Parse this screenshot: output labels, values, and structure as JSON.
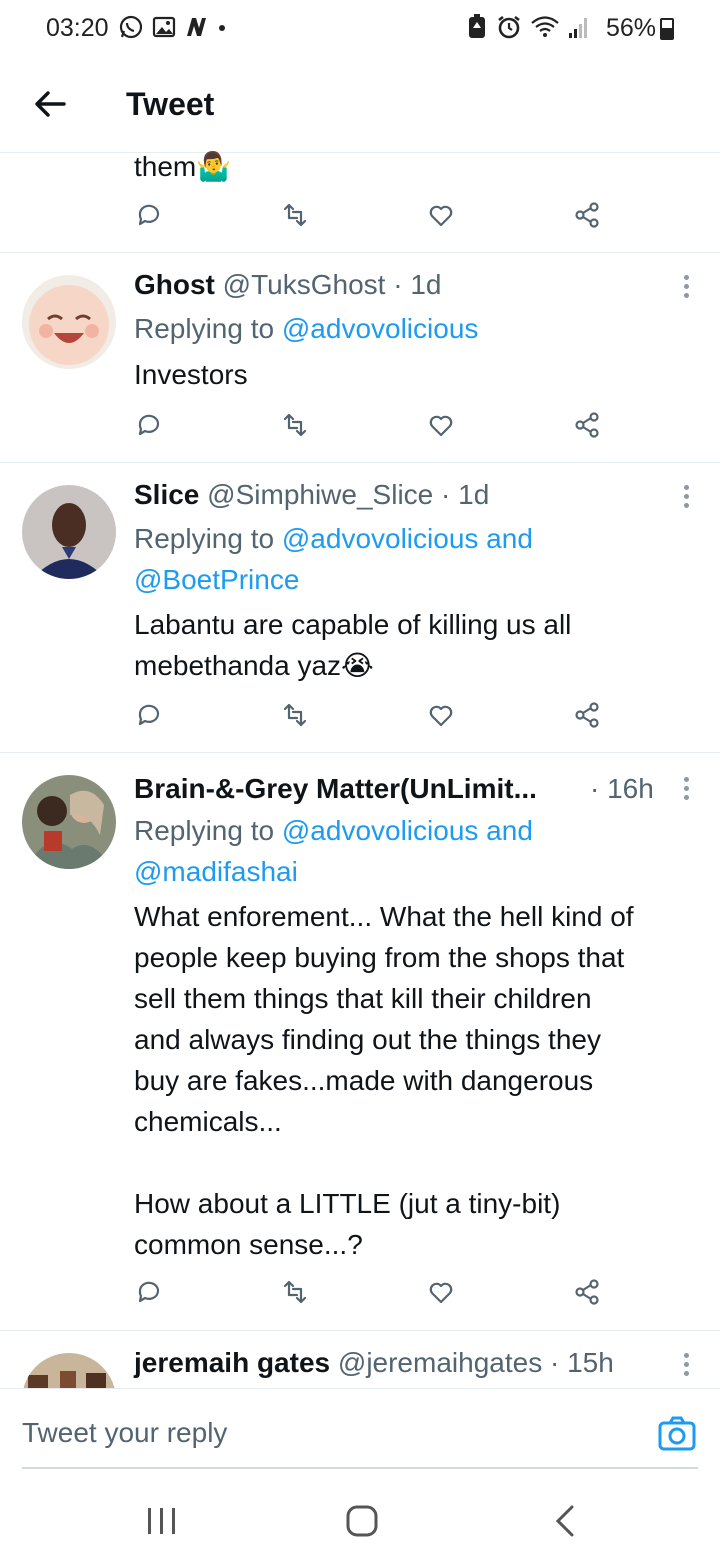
{
  "status_bar": {
    "time": "03:20",
    "battery": "56%",
    "left_icons": [
      "whatsapp-icon",
      "gallery-icon",
      "news-icon",
      "dot-icon"
    ],
    "right_icons": [
      "battery-saver-icon",
      "alarm-icon",
      "wifi-icon",
      "signal-icon",
      "battery-icon"
    ]
  },
  "header": {
    "title": "Tweet",
    "back_icon": "arrow-left-icon"
  },
  "partial_tweet": {
    "text": "them🤷‍♂️"
  },
  "replies": [
    {
      "name": "Ghost",
      "meta": "@TuksGhost · 1d",
      "replying_prefix": "Replying to",
      "replying_to": "@advovolicious",
      "text": "Investors"
    },
    {
      "name": "Slice",
      "meta": "@Simphiwe_Slice · 1d",
      "replying_prefix": "Replying to",
      "replying_to": "@advovolicious and",
      "replying_to_2": "@BoetPrince",
      "text": "Labantu are capable of killing us all\nmebethanda yaz😭"
    },
    {
      "name": "Brain-&-Grey Matter(UnLimit...",
      "meta": "· 16h",
      "replying_prefix": "Replying to",
      "replying_to": "@advovolicious and",
      "replying_to_2": "@madifashai",
      "text": "What enforement... What the hell kind of\npeople keep buying from the shops that\nsell them things that kill their children\nand always finding out the things they\nbuy are fakes...made with dangerous\nchemicals...\n\nHow about a LITTLE (jut a tiny-bit)\ncommon sense...?"
    },
    {
      "name": "jeremaih gates",
      "meta": "@jeremaihgates · 15h"
    }
  ],
  "reply_bar": {
    "placeholder": "Tweet your reply",
    "camera_icon": "camera-icon"
  },
  "nav": [
    "recents-icon",
    "home-icon",
    "back-icon"
  ],
  "colors": {
    "accent": "#1d9bf0",
    "text": "#0f1419",
    "muted": "#536471",
    "divider": "#e6ecf0"
  }
}
